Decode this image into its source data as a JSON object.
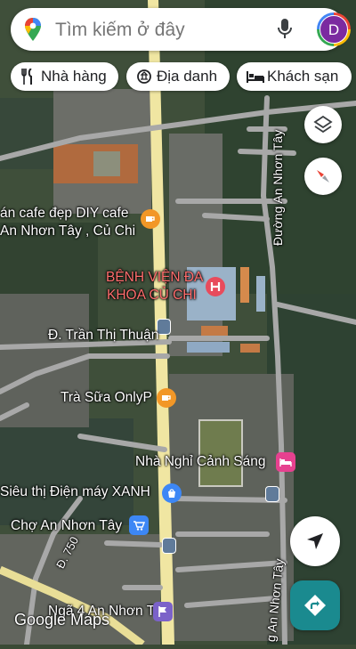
{
  "search": {
    "placeholder": "Tìm kiếm ở đây",
    "avatar_letter": "D"
  },
  "chips": [
    {
      "label": "Nhà hàng",
      "icon": "fork-knife-icon"
    },
    {
      "label": "Địa danh",
      "icon": "landmark-icon"
    },
    {
      "label": "Khách sạn",
      "icon": "bed-icon"
    }
  ],
  "map": {
    "places": {
      "cafe_diy_line1": "án cafe đẹp DIY cafe",
      "cafe_diy_line2": "An Nhơn Tây , Củ Chi",
      "hospital_line1": "BỆNH VIỆN ĐA",
      "hospital_line2": "KHOA CỦ CHI",
      "tran_thi_thuan": "Đ. Trần Thị Thuận",
      "tra_sua": "Trà Sữa OnlyP",
      "nha_nghi": "Nhà Nghỉ Cảnh Sáng",
      "sieu_thi": "Siêu thị Điện máy XANH",
      "cho": "Chợ An Nhơn Tây",
      "nga4": "Ngã 4 An Nhơn Tây"
    },
    "roads": {
      "duong_an_nhon_tay_upper": "Đường An Nhơn Tây",
      "duong_an_nhon_tay_lower": "g An Nhơn Tây",
      "d750": "Đ. 750"
    },
    "watermark": "Google Maps"
  },
  "colors": {
    "cafe": "#f29727",
    "hospital": "#e84b5c",
    "hotel": "#e6418f",
    "shop": "#3d87f5",
    "directions": "#1a8a8f"
  }
}
